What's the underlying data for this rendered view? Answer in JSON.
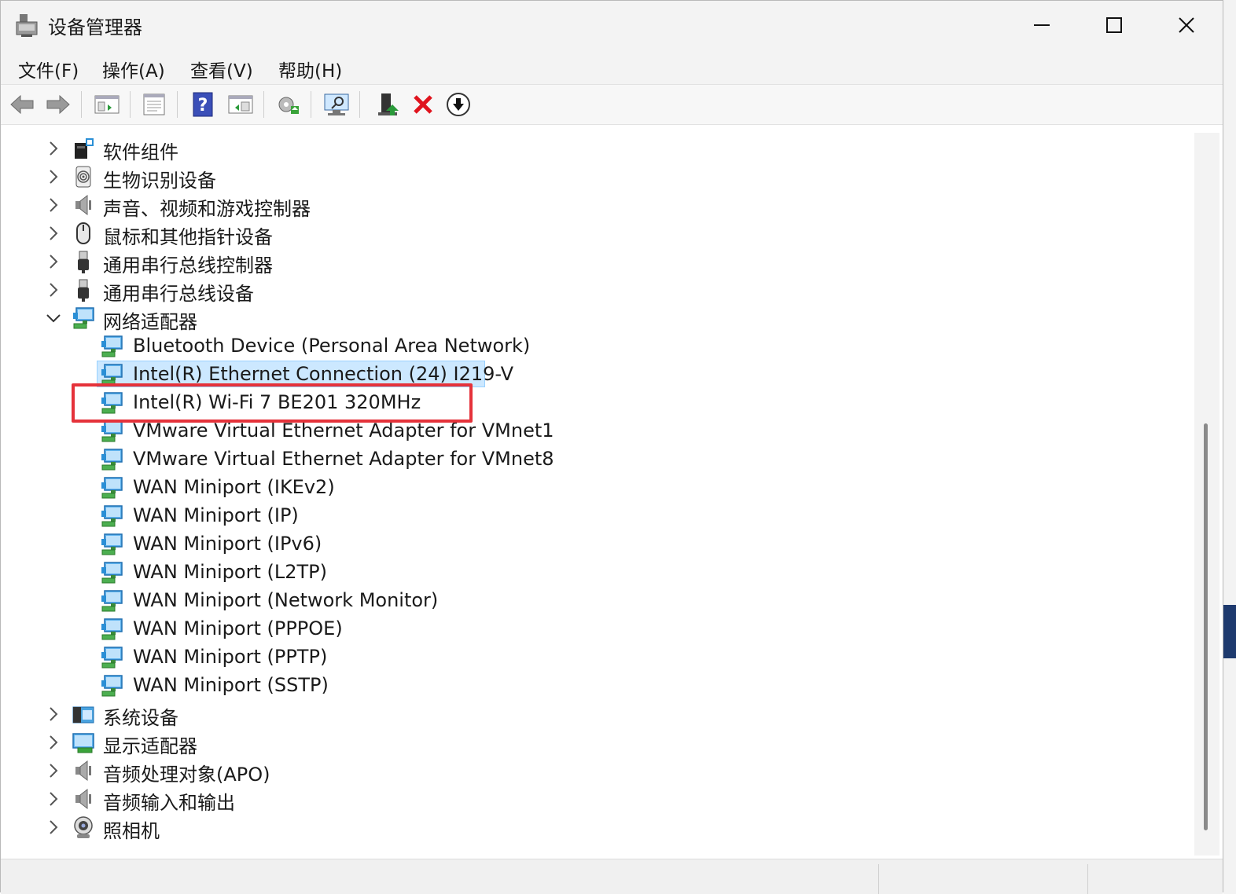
{
  "window": {
    "title": "设备管理器"
  },
  "menu": [
    {
      "label": "文件(F)"
    },
    {
      "label": "操作(A)"
    },
    {
      "label": "查看(V)"
    },
    {
      "label": "帮助(H)"
    }
  ],
  "toolbar": {
    "icons": [
      "back-icon",
      "forward-icon",
      "show-hide-tree-icon",
      "properties-icon",
      "help-icon",
      "action-view-icon",
      "update-driver-icon",
      "scan-hardware-icon",
      "enable-device-icon",
      "uninstall-device-icon",
      "disable-device-icon"
    ]
  },
  "tree": {
    "categories_before": [
      {
        "label": "软件组件",
        "icon": "software-component-icon"
      },
      {
        "label": "生物识别设备",
        "icon": "fingerprint-icon"
      },
      {
        "label": "声音、视频和游戏控制器",
        "icon": "speaker-icon"
      },
      {
        "label": "鼠标和其他指针设备",
        "icon": "mouse-icon"
      },
      {
        "label": "通用串行总线控制器",
        "icon": "usb-icon"
      },
      {
        "label": "通用串行总线设备",
        "icon": "usb-icon"
      }
    ],
    "expanded_category": {
      "label": "网络适配器",
      "icon": "network-adapter-icon"
    },
    "network_adapters": [
      {
        "label": "Bluetooth Device (Personal Area Network)"
      },
      {
        "label": "Intel(R) Ethernet Connection (24) I219-V",
        "selected": true
      },
      {
        "label": "Intel(R) Wi-Fi 7 BE201 320MHz",
        "highlighted": true
      },
      {
        "label": "VMware Virtual Ethernet Adapter for VMnet1"
      },
      {
        "label": "VMware Virtual Ethernet Adapter for VMnet8"
      },
      {
        "label": "WAN Miniport (IKEv2)"
      },
      {
        "label": "WAN Miniport (IP)"
      },
      {
        "label": "WAN Miniport (IPv6)"
      },
      {
        "label": "WAN Miniport (L2TP)"
      },
      {
        "label": "WAN Miniport (Network Monitor)"
      },
      {
        "label": "WAN Miniport (PPPOE)"
      },
      {
        "label": "WAN Miniport (PPTP)"
      },
      {
        "label": "WAN Miniport (SSTP)"
      }
    ],
    "categories_after": [
      {
        "label": "系统设备",
        "icon": "system-device-icon"
      },
      {
        "label": "显示适配器",
        "icon": "display-adapter-icon"
      },
      {
        "label": "音频处理对象(APO)",
        "icon": "speaker-icon"
      },
      {
        "label": "音频输入和输出",
        "icon": "speaker-icon"
      },
      {
        "label": "照相机",
        "icon": "camera-icon"
      }
    ]
  },
  "colors": {
    "selection": "#cce8ff",
    "highlight_box": "#e5323a",
    "network_icon": "#2a8fd6"
  }
}
